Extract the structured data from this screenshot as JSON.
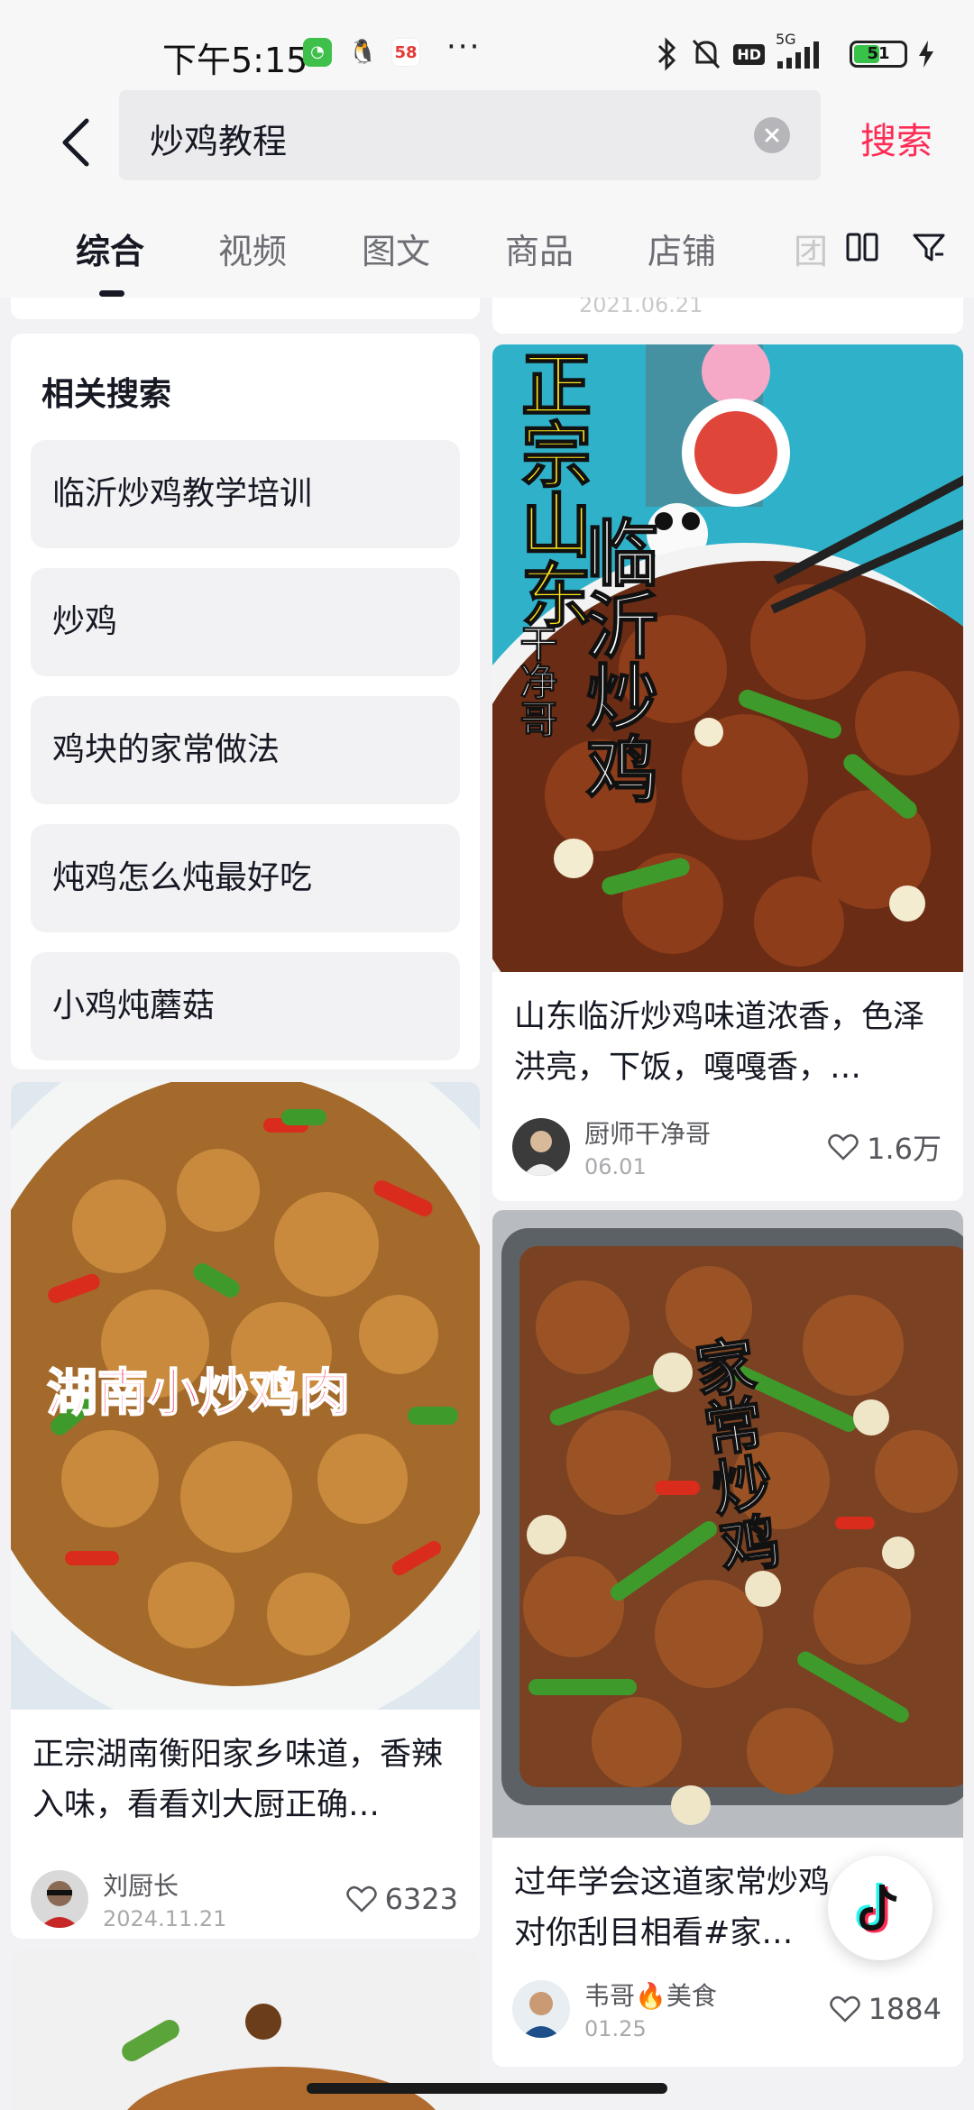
{
  "status_bar": {
    "time": "下午5:15",
    "app_58": "58",
    "network": "5G",
    "hd": "HD",
    "battery": "51"
  },
  "search": {
    "query": "炒鸡教程",
    "search_label": "搜索"
  },
  "tabs": [
    {
      "label": "综合",
      "active": true
    },
    {
      "label": "视频"
    },
    {
      "label": "图文"
    },
    {
      "label": "商品"
    },
    {
      "label": "店铺"
    },
    {
      "label": "团"
    }
  ],
  "related": {
    "title": "相关搜索",
    "items": [
      "临沂炒鸡教学培训",
      "炒鸡",
      "鸡块的家常做法",
      "炖鸡怎么炖最好吃",
      "小鸡炖蘑菇"
    ]
  },
  "right_stub_date": "2021.06.21",
  "cards": {
    "linyi": {
      "overlay_yellow": "正宗山东",
      "overlay_small": "干净哥",
      "overlay_white": "临沂炒鸡",
      "title": "山东临沂炒鸡味道浓香，色泽洪亮，下饭，嘎嘎香，…",
      "author": "厨师干净哥",
      "date": "06.01",
      "likes": "1.6万"
    },
    "hunan": {
      "overlay": "湖南小炒鸡肉",
      "title": "正宗湖南衡阳家乡味道，香辣入味，看看刘大厨正确…",
      "author": "刘厨长",
      "date": "2024.11.21",
      "likes": "6323"
    },
    "jiachang": {
      "overlay": "家常炒鸡",
      "title": "过年学会这道家常炒鸡，家人对你刮目相看#家…",
      "author": "韦哥🔥美食",
      "date": "01.25",
      "likes": "1884"
    }
  },
  "colors": {
    "accent": "#fe2c55",
    "text_primary": "#161823",
    "text_secondary": "#56575c"
  }
}
